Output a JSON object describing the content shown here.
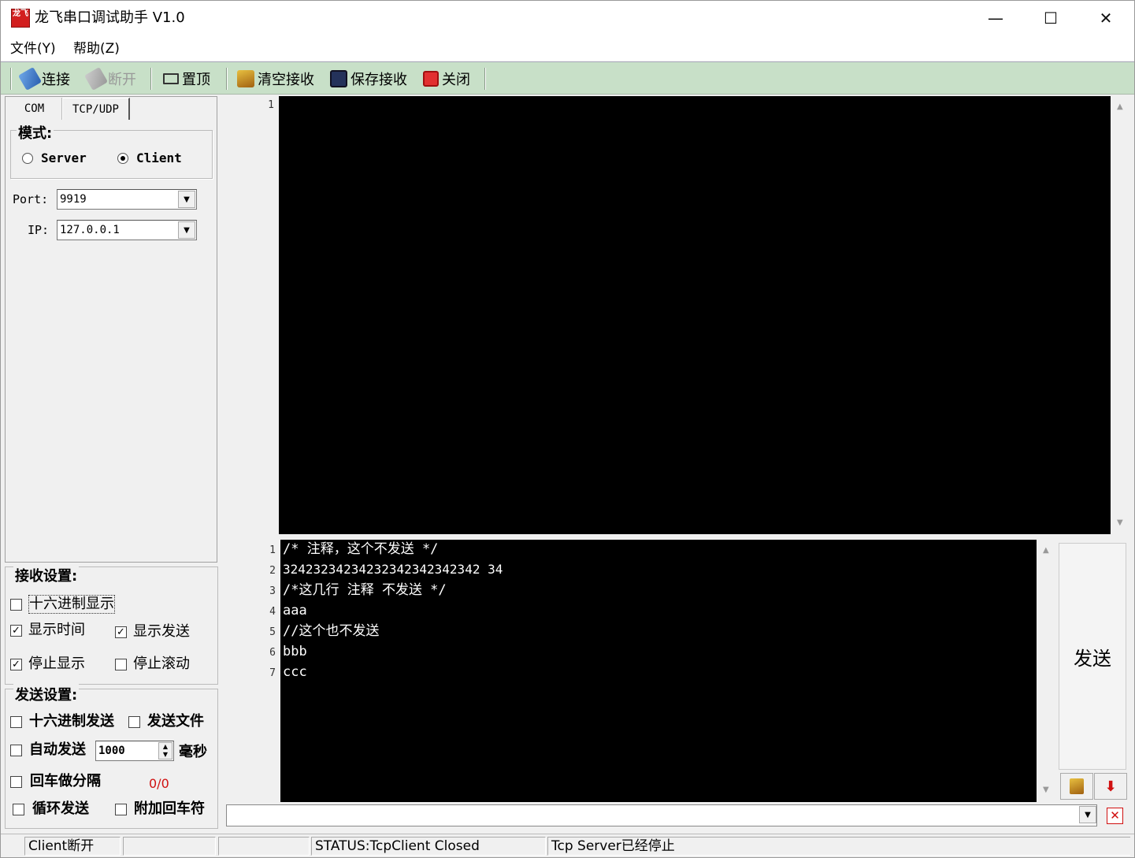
{
  "window": {
    "icon_text": "龙飞",
    "title": "龙飞串口调试助手 V1.0",
    "minimize_glyph": "—",
    "maximize_glyph": "☐",
    "close_glyph": "✕"
  },
  "menu": {
    "file": "文件(Y)",
    "help": "帮助(Z)"
  },
  "toolbar": {
    "connect": "连接",
    "disconnect": "断开",
    "pin_top": "置顶",
    "clear_receive": "清空接收",
    "save_receive": "保存接收",
    "close": "关闭"
  },
  "tabs": {
    "com": "COM",
    "tcp_udp": "TCP/UDP"
  },
  "mode": {
    "title": "模式:",
    "server": "Server",
    "client": "Client",
    "selected": "Client"
  },
  "port": {
    "label": "Port:",
    "value": "9919"
  },
  "ip": {
    "label": "IP:",
    "value": "127.0.0.1"
  },
  "receive_settings": {
    "title": "接收设置:",
    "hex_display": {
      "label": "十六进制显示",
      "checked": false
    },
    "show_time": {
      "label": "显示时间",
      "checked": true
    },
    "show_send": {
      "label": "显示发送",
      "checked": true
    },
    "stop_display": {
      "label": "停止显示",
      "checked": true
    },
    "stop_scroll": {
      "label": "停止滚动",
      "checked": false
    }
  },
  "send_settings": {
    "title": "发送设置:",
    "hex_send": {
      "label": "十六进制发送",
      "checked": false
    },
    "send_file": {
      "label": "发送文件",
      "checked": false
    },
    "auto_send": {
      "label": "自动发送",
      "checked": false
    },
    "interval_value": "1000",
    "interval_unit": "毫秒",
    "newline_split": {
      "label": "回车做分隔",
      "checked": false
    },
    "counter": "0/0",
    "loop_send": {
      "label": "循环发送",
      "checked": false
    },
    "append_newline": {
      "label": "附加回车符",
      "checked": false
    }
  },
  "receive_editor": {
    "line_numbers": [
      "1"
    ]
  },
  "send_editor": {
    "line_numbers": [
      "1",
      "2",
      "3",
      "4",
      "5",
      "6",
      "7"
    ],
    "lines": [
      "/* 注释，这个不发送 */",
      "32423234234232342342342342 34",
      "/*这几行 注释 不发送 */",
      "aaa",
      "//这个也不发送",
      "bbb",
      "ccc"
    ]
  },
  "send_button": "发送",
  "status": {
    "client": "Client断开",
    "blank1": "",
    "blank2": "",
    "state": "STATUS:TcpClient Closed",
    "server": "Tcp Server已经停止"
  },
  "colors": {
    "toolbar_bg": "#c8e0c8",
    "editor_bg": "#000000",
    "counter": "#d01010"
  }
}
